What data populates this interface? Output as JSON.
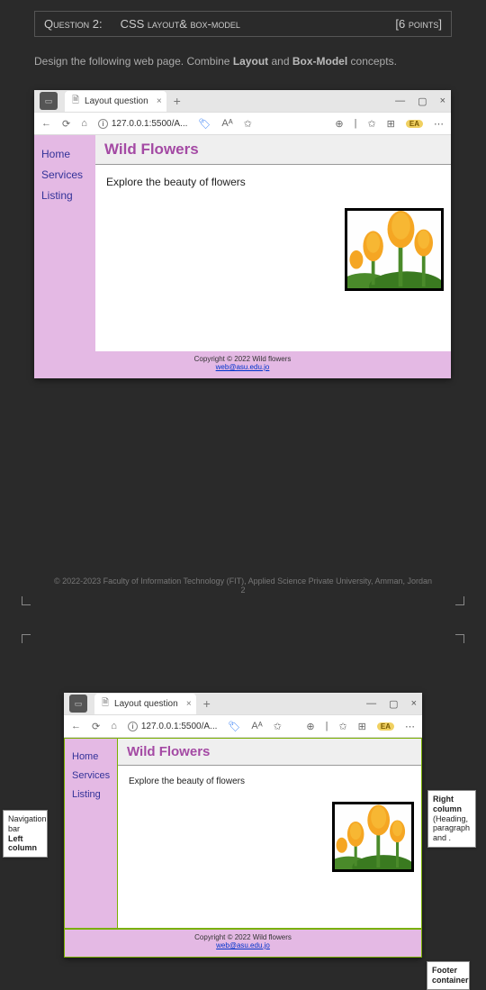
{
  "question": {
    "number_label": "Question 2:",
    "topic": "CSS layout& box-model",
    "points": "[6 points]"
  },
  "intro": {
    "pre": "Design the following web page. Combine ",
    "b1": "Layout",
    "mid": " and ",
    "b2": "Box-Model",
    "post": " concepts."
  },
  "browser": {
    "tab_title": "Layout question",
    "url": "127.0.0.1:5500/A...",
    "badge": "EA"
  },
  "page": {
    "nav": [
      "Home",
      "Services",
      "Listing"
    ],
    "heading": "Wild Flowers",
    "paragraph": "Explore the beauty of flowers",
    "footer_copy": "Copyright © 2022 Wild flowers",
    "footer_link": "web@asu.edu.jo"
  },
  "doc_footer": {
    "copy": "© 2022-2023 Faculty of Information Technology (FIT), Applied Science Private University, Amman, Jordan",
    "page_num": "2"
  },
  "annotations": {
    "left": {
      "l1": "Navigation bar",
      "l2": "Left column"
    },
    "right": {
      "l1": "Right column",
      "l2": "(Heading, paragraph and ."
    },
    "footer": {
      "l1": "Footer container"
    }
  }
}
